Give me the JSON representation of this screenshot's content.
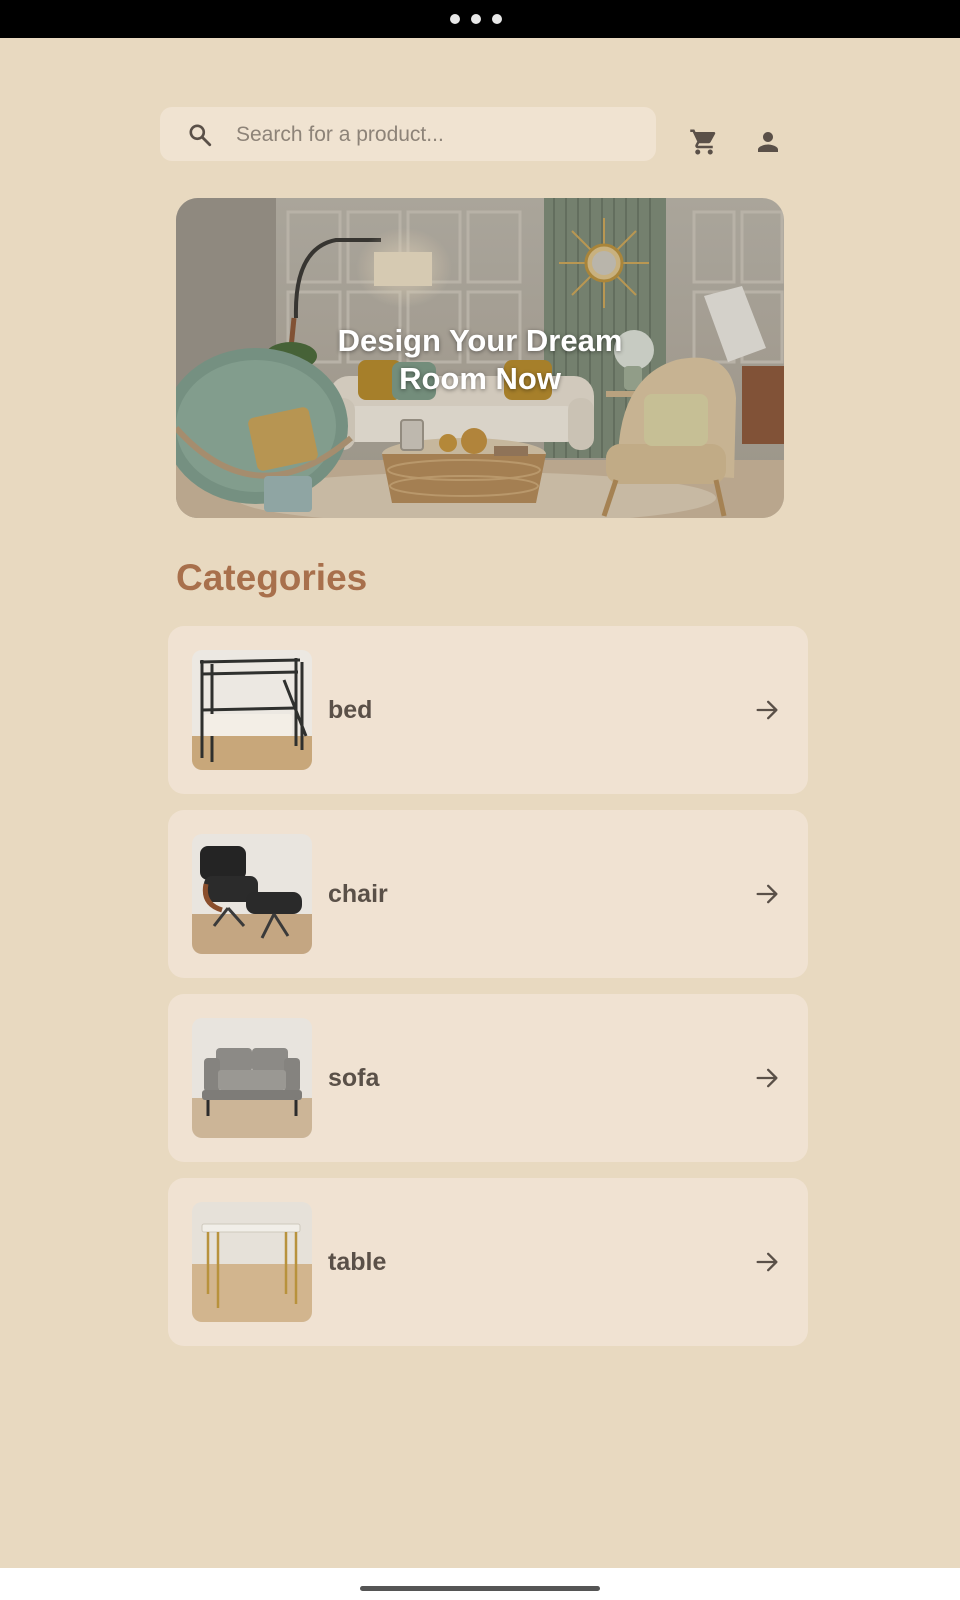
{
  "search": {
    "placeholder": "Search for a product..."
  },
  "hero": {
    "title_line1": "Design Your Dream",
    "title_line2": "Room Now"
  },
  "categories_title": "Categories",
  "categories": [
    {
      "label": "bed",
      "icon": "arrow-right-icon"
    },
    {
      "label": "chair",
      "icon": "arrow-right-icon"
    },
    {
      "label": "sofa",
      "icon": "arrow-right-icon"
    },
    {
      "label": "table",
      "icon": "arrow-right-icon"
    }
  ],
  "icons": {
    "search": "search-icon",
    "cart": "cart-icon",
    "account": "account-icon"
  },
  "colors": {
    "background": "#e8d9c0",
    "card": "#f0e2d2",
    "accent": "#a8704c",
    "text": "#5a5048"
  }
}
